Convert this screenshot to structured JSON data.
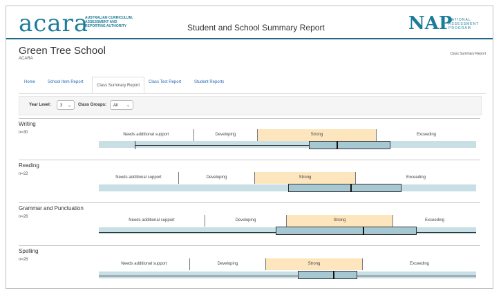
{
  "header": {
    "logo_text": "acara",
    "logo_sub": [
      "AUSTRALIAN CURRICULUM,",
      "ASSESSMENT AND",
      "REPORTING AUTHORITY"
    ],
    "title": "Student and School Summary Report",
    "nap_text": "NAP",
    "nap_sub": [
      "NATIONAL",
      "ASSESSMENT",
      "PROGRAM"
    ]
  },
  "school": {
    "name": "Green Tree School",
    "code": "ACARA",
    "report_label": "Class Summary Report"
  },
  "tabs": [
    {
      "label": "Home"
    },
    {
      "label": "School Item Report"
    },
    {
      "label": "Class Summary Report"
    },
    {
      "label": "Class Test Report"
    },
    {
      "label": "Student Reports"
    }
  ],
  "filters": {
    "year_level_label": "Year Level:",
    "year_level_value": "3",
    "class_groups_label": "Class Groups:",
    "class_groups_value": "All"
  },
  "colors": {
    "accent": "#1c7c9a",
    "strong_band": "#fde6bd",
    "axis_band": "#c8dfe5",
    "box_fill": "#a6c8d2"
  },
  "sections": [
    {
      "title": "Writing",
      "n": "n=30",
      "bands": [
        "Needs additional support",
        "Developing",
        "Strong",
        "Exceeding"
      ]
    },
    {
      "title": "Reading",
      "n": "n=22",
      "bands": [
        "Needs additional support",
        "Developing",
        "Strong",
        "Exceeding"
      ]
    },
    {
      "title": "Grammar and Punctuation",
      "n": "n=26",
      "bands": [
        "Needs additional support",
        "Developing",
        "Strong",
        "Exceeding"
      ]
    },
    {
      "title": "Spelling",
      "n": "n=26",
      "bands": [
        "Needs additional support",
        "Developing",
        "Strong",
        "Exceeding"
      ]
    }
  ]
}
